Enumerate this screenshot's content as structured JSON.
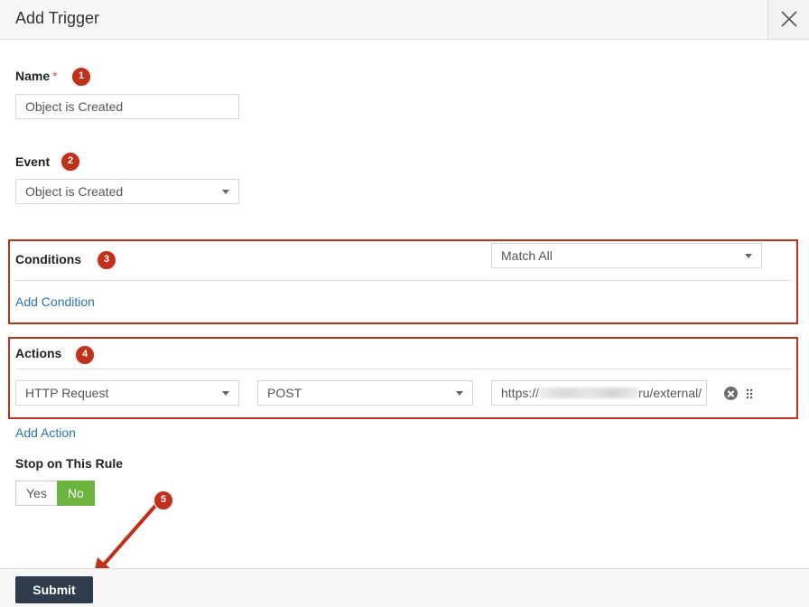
{
  "dialog": {
    "title": "Add Trigger"
  },
  "name": {
    "label": "Name",
    "required_mark": "*",
    "value": "Object is Created"
  },
  "event": {
    "label": "Event",
    "selected": "Object is Created"
  },
  "conditions": {
    "label": "Conditions",
    "match_selected": "Match All",
    "add_link": "Add Condition"
  },
  "actions": {
    "label": "Actions",
    "action_type": "HTTP Request",
    "method": "POST",
    "url_prefix": "https://",
    "url_suffix": "ru/external/",
    "add_link": "Add Action"
  },
  "stop_rule": {
    "label": "Stop on This Rule",
    "yes": "Yes",
    "no": "No",
    "selected": "No"
  },
  "footer": {
    "submit_label": "Submit"
  },
  "annotations": [
    "1",
    "2",
    "3",
    "4",
    "5"
  ],
  "colors": {
    "annotation": "#c0311c",
    "link": "#2d73b8",
    "toggle_on": "#6db33f",
    "submit_bg": "#2f3c4c"
  },
  "icons": {
    "close": "close-icon",
    "remove": "remove-circle-icon",
    "drag": "drag-handle-icon",
    "caret": "chevron-down-icon"
  }
}
